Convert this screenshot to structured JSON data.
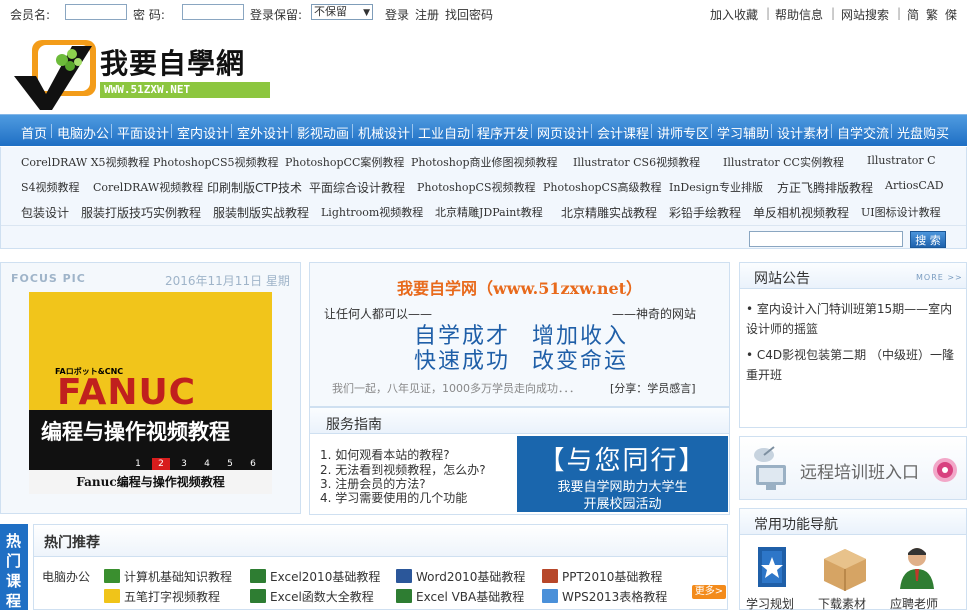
{
  "topbar": {
    "member_label": "会员名:",
    "password_label": "密 码:",
    "keep_label": "登录保留:",
    "keep_value": "不保留",
    "login": "登录",
    "register": "注册",
    "recover": "找回密码",
    "right_links": [
      "加入收藏",
      "帮助信息",
      "网站搜索",
      "简",
      "繁",
      "傑"
    ]
  },
  "logo": {
    "name": "我要自學網",
    "url": "WWW.51ZXW.NET"
  },
  "mainnav": [
    "首页",
    "电脑办公",
    "平面设计",
    "室内设计",
    "室外设计",
    "影视动画",
    "机械设计",
    "工业自动",
    "程序开发",
    "网页设计",
    "会计课程",
    "讲师专区",
    "学习辅助",
    "设计素材",
    "自学交流",
    "光盘购买"
  ],
  "sublinks": {
    "row1": [
      "CorelDRAW X5视频教程",
      "PhotoshopCS5视频教程",
      "PhotoshopCC案例教程",
      "Photoshop商业修图视频教程",
      "Illustrator CS6视频教程",
      "Illustrator CC实例教程",
      "Illustrator C"
    ],
    "row2": [
      "S4视频教程",
      "CorelDRAW视频教程",
      "印刷制版CTP技术",
      "平面综合设计教程",
      "PhotoshopCS视频教程",
      "PhotoshopCS高级教程",
      "InDesign专业排版",
      "方正飞腾排版教程",
      "ArtiosCAD"
    ],
    "row3": [
      "包装设计",
      "服装打版技巧实例教程",
      "服装制版实战教程",
      "Lightroom视频教程",
      "北京精雕JDPaint教程",
      "北京精雕实战教程",
      "彩铅手绘教程",
      "单反相机视频教程",
      "UI图标设计教程"
    ],
    "search_button": "搜 索"
  },
  "focus": {
    "title": "FOCUS PIC",
    "date": "2016年11月11日 星期五",
    "pic_small": "FAロボット&CNC",
    "pic_brand": "FANUC",
    "pic_text": "编程与操作视频教程",
    "pic_nums": [
      "1",
      "2",
      "3",
      "4",
      "5",
      "6"
    ],
    "caption": "Fanuc编程与操作视频教程"
  },
  "hero": {
    "title": "我要自学网（www.51zxw.net）",
    "left_line": "让任何人都可以——",
    "right_line": "——神奇的网站",
    "phrases": [
      "自学成才",
      "增加收入",
      "快速成功",
      "改变命运"
    ],
    "foot_left": "我们一起，八年见证，1000多万学员走向成功．．．",
    "foot_right": "[分享：学员感言]"
  },
  "guide": {
    "title": "服务指南",
    "items": [
      "1. 如何观看本站的教程?",
      "2. 无法看到视频教程，怎么办?",
      "3. 注册会员的方法?",
      "4. 学习需要使用的几个功能"
    ],
    "ad_line1": "【与您同行】",
    "ad_line2": "我要自学网助力大学生",
    "ad_line3": "开展校园活动"
  },
  "notice": {
    "title": "网站公告",
    "more": "MORE >>",
    "items": [
      "室内设计入门特训班第15期——室内设计师的摇篮",
      "C4D影视包装第二期 （中级班）一隆重开班"
    ]
  },
  "remote": {
    "label": "远程培训班入口"
  },
  "funcnav": {
    "title": "常用功能导航",
    "items": [
      "学习规划",
      "下载素材",
      "应聘老师"
    ]
  },
  "hot": {
    "side_chars": [
      "热",
      "门",
      "课",
      "程"
    ],
    "title": "热门推荐",
    "category": "电脑办公",
    "items": [
      {
        "label": "计算机基础知识教程",
        "color": "#3a8f2f"
      },
      {
        "label": "五笔打字视频教程",
        "color": "#f0c419"
      },
      {
        "label": "Excel2010基础教程",
        "color": "#2e7d32"
      },
      {
        "label": "Excel函数大全教程",
        "color": "#2e7d32"
      },
      {
        "label": "Word2010基础教程",
        "color": "#2b579a"
      },
      {
        "label": "Excel VBA基础教程",
        "color": "#2e7d32"
      },
      {
        "label": "PPT2010基础教程",
        "color": "#b7472a"
      },
      {
        "label": "WPS2013表格教程",
        "color": "#4a90d9"
      }
    ],
    "more": "更多>"
  }
}
